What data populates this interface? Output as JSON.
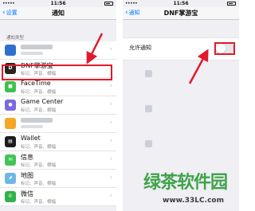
{
  "left_screen": {
    "status": {
      "signal": "•••••",
      "time": "11:56"
    },
    "nav": {
      "back_label": "设置",
      "title": "通知"
    },
    "section_header": "通知类型",
    "rows": [
      {
        "name": "",
        "subtitle": "",
        "icon_color": "#2f6fcf",
        "blurred": true
      },
      {
        "name": "DNF掌游宝",
        "subtitle": "标记、声音、横幅",
        "icon_color": "#2a2320",
        "icon_glyph": "D"
      },
      {
        "name": "FaceTime",
        "subtitle": "标记、声音、横幅",
        "icon_color": "#3cc24a",
        "icon_glyph": "■"
      },
      {
        "name": "Game Center",
        "subtitle": "标记、声音、横幅",
        "icon_color": "#7a6ae0",
        "icon_glyph": "●"
      },
      {
        "name": "",
        "subtitle": "",
        "icon_color": "#f5a623",
        "blurred": true
      },
      {
        "name": "Wallet",
        "subtitle": "标记、声音、横幅",
        "icon_color": "#1c1c1e",
        "icon_glyph": "▤"
      },
      {
        "name": "信息",
        "subtitle": "标记、声音、横幅",
        "icon_color": "#43c456",
        "icon_glyph": "✉"
      },
      {
        "name": "地图",
        "subtitle": "标记、声音、横幅",
        "icon_color": "#6fb6e8",
        "icon_glyph": "⬈"
      },
      {
        "name": "微信",
        "subtitle": "标记、声音、横幅",
        "icon_color": "#2fb24a",
        "icon_glyph": "✆"
      }
    ]
  },
  "right_screen": {
    "status": {
      "signal": "•••••",
      "time": "11:56"
    },
    "nav": {
      "back_label": "通知",
      "title": "DNF掌游宝"
    },
    "allow_notifications_label": "允许通知",
    "allow_notifications_on": false
  },
  "watermark": {
    "brand": "绿茶软件园",
    "url": "www.33LC.com"
  },
  "colors": {
    "accent": "#007aff",
    "annotation": "#e11a2b",
    "brand_green": "#3fa34a"
  }
}
